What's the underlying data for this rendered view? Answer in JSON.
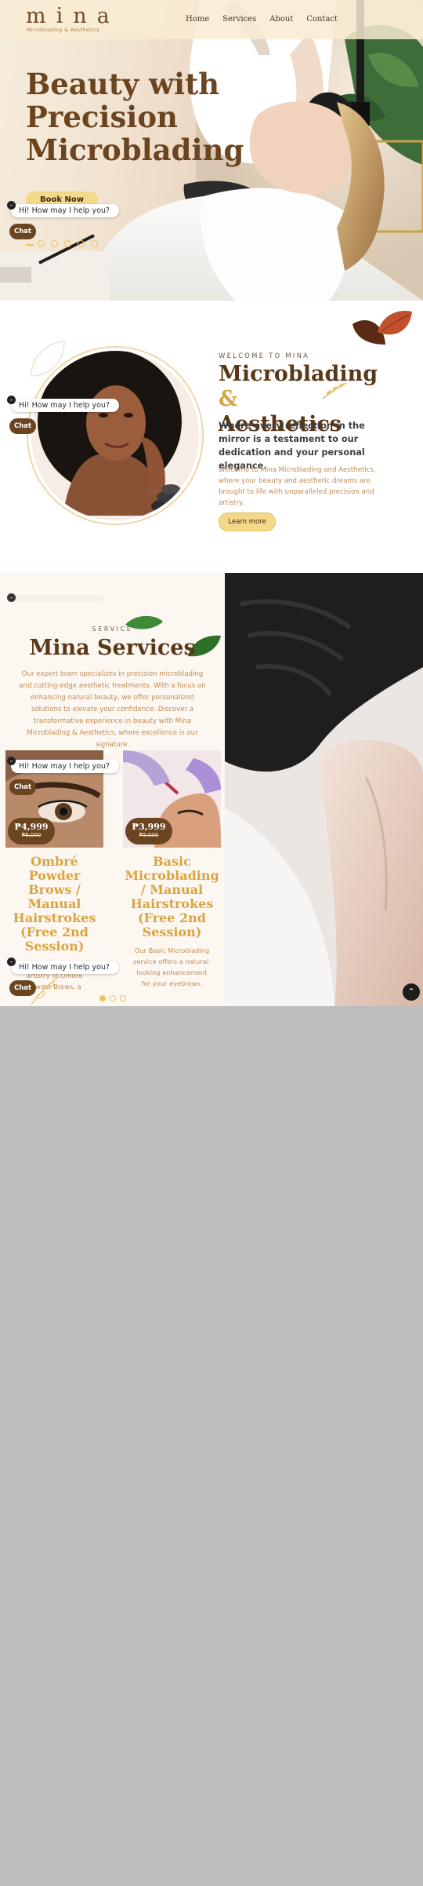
{
  "header": {
    "logo": "mina",
    "logo_tagline": "Microblading & Aesthetics",
    "nav": [
      "Home",
      "Services",
      "About",
      "Contact"
    ]
  },
  "hero": {
    "title": "Beauty with Precision Microblading",
    "cta": "Book Now"
  },
  "chat": {
    "prompt": "Hi! How may I help you?",
    "button": "Chat",
    "close": "–"
  },
  "welcome": {
    "kicker": "WELCOME TO MINA",
    "title_main": "Microblading",
    "title_amp": "&",
    "title_line2": "Aesthetics",
    "lead": "Where every reflection in the mirror is a testament to our dedication and your personal elegance.",
    "body": "Welcome to Mina Microblading and Aesthetics, where your beauty and aesthetic dreams are brought to life with unparalleled precision and artistry.",
    "cta": "Learn more"
  },
  "services": {
    "kicker": "SERVICE",
    "title": "Mina Services",
    "body": "Our expert team specializes in precision microblading and cutting-edge aesthetic treatments. With a focus on enhancing natural beauty, we offer personalized solutions to elevate your confidence. Discover a transformative experience in beauty with Mina Microblading & Aesthetics, where excellence is our signature.",
    "cards": [
      {
        "price": "₱4,999",
        "old_price": "₱6,000",
        "title": "Ombré Powder Brows / Manual Hairstrokes (Free 2nd Session)",
        "desc": "Experience the modern artistry of Ombré Powder Brows, a technique that gives a soft powder-filled"
      },
      {
        "price": "₱3,999",
        "old_price": "₱5,000",
        "title": "Basic Microblading / Manual Hairstrokes (Free 2nd Session)",
        "desc": "Our Basic Microblading service offers a natural-looking enhancement for your eyebrows."
      }
    ],
    "slider_active": 1,
    "slider_count": 3
  },
  "to_top": "⌃",
  "colors": {
    "brand_brown": "#6b4420",
    "gold": "#d9a441",
    "button_gold": "#f3d98a",
    "body_text_tan": "#c08b52"
  }
}
